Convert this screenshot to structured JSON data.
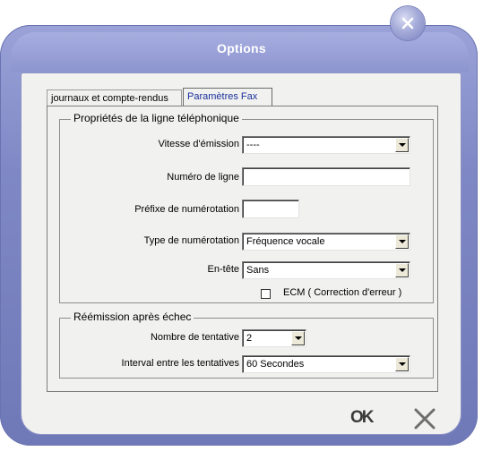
{
  "window": {
    "title": "Options"
  },
  "tabs": [
    {
      "label": "journaux et compte-rendus",
      "active": false
    },
    {
      "label": "Paramètres Fax",
      "active": true
    }
  ],
  "line_properties": {
    "legend": "Propriétés de la ligne téléphonique",
    "emission_speed": {
      "label": "Vitesse d'émission",
      "value": "----"
    },
    "line_number": {
      "label": "Numéro de ligne",
      "value": ""
    },
    "dial_prefix": {
      "label": "Préfixe de numérotation",
      "value": ""
    },
    "dial_type": {
      "label": "Type de numérotation",
      "value": "Fréquence vocale"
    },
    "header": {
      "label": "En-tête",
      "value": "Sans"
    },
    "ecm": {
      "label": "ECM ( Correction d'erreur )",
      "checked": false
    }
  },
  "retry": {
    "legend": "Réémission après échec",
    "attempts": {
      "label": "Nombre de tentative",
      "value": "2"
    },
    "interval": {
      "label": "Interval entre les tentatives",
      "value": "60 Secondes"
    }
  },
  "footer": {
    "ok_label": "OK",
    "cancel_icon": "x-icon"
  },
  "colors": {
    "frame": "#7f88c4",
    "panel": "#f1f1ef",
    "active_tab_text": "#1a2f9c"
  }
}
